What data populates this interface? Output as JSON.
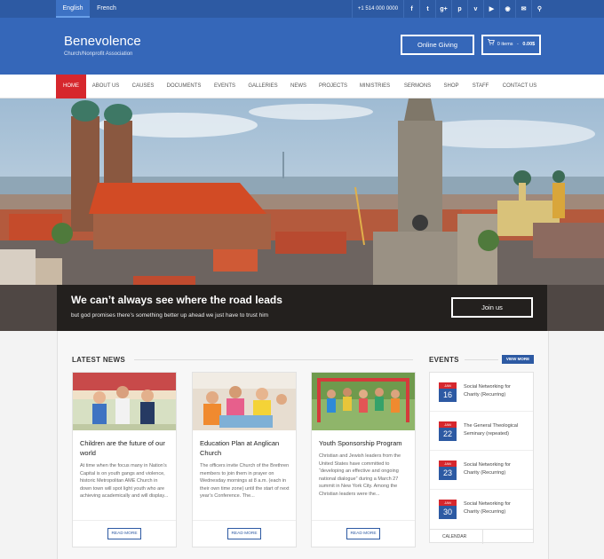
{
  "topbar": {
    "languages": [
      {
        "label": "English",
        "active": true
      },
      {
        "label": "French",
        "active": false
      }
    ],
    "phone": "+1 514 000 0000",
    "social_icons": [
      "facebook-icon",
      "twitter-icon",
      "google-plus-icon",
      "pinterest-icon",
      "vimeo-icon",
      "youtube-icon",
      "rss-icon",
      "email-icon",
      "search-icon"
    ],
    "social_glyphs": [
      "f",
      "t",
      "g+",
      "p",
      "v",
      "▶",
      "◉",
      "✉",
      "⚲"
    ]
  },
  "header": {
    "brand": "Benevolence",
    "tagline": "Church/Nonprofit Association",
    "giving_label": "Online Giving",
    "cart_items": "0 items",
    "cart_sep": " - ",
    "cart_total": "0.00$"
  },
  "nav": {
    "items": [
      "HOME",
      "ABOUT US",
      "CAUSES",
      "DOCUMENTS",
      "EVENTS",
      "GALLERIES",
      "NEWS",
      "PROJECTS",
      "MINISTRIES",
      "SERMONS",
      "SHOP",
      "STAFF",
      "CONTACT US"
    ],
    "active": "HOME"
  },
  "hero": {
    "title": "We can’t always see where the road leads",
    "subtitle": "but god promises there’s something better up ahead we just have to trust him",
    "button": "Join us"
  },
  "news": {
    "title": "LATEST NEWS",
    "read_more": "READ MORE",
    "articles": [
      {
        "title": "Children are the future of our world",
        "excerpt": "At time when the focus many in Nation’s Capital is on youth gangs and violence, historic Metropolitan AME Church in down town will spot light youth who are achieving academically and will display..."
      },
      {
        "title": "Education Plan at Anglican Church",
        "excerpt": "The officers invite Church of the Brethren members to join them in prayer on Wednesday mornings at 8 a.m. (each in their own time zone) until the start of next year’s Conference. The..."
      },
      {
        "title": "Youth Sponsorship Program",
        "excerpt": "Christian and Jewish leaders from the United States have committed to “developing an effective and ongoing national dialogue” during a March 27 summit in New York City. Among the Christian leaders were the..."
      }
    ]
  },
  "events": {
    "title": "EVENTS",
    "view_more": "VIEW MORE",
    "items": [
      {
        "month": "JAN",
        "day": "16",
        "title": "Social Networking for Charity (Recurring)"
      },
      {
        "month": "JAN",
        "day": "22",
        "title": "The General Theological Seminary (repeated)"
      },
      {
        "month": "JAN",
        "day": "23",
        "title": "Social Networking for Charity (Recurring)"
      },
      {
        "month": "JAN",
        "day": "30",
        "title": "Social Networking for Charity (Recurring)"
      }
    ],
    "calendar": "CALENDAR"
  },
  "colors": {
    "primary": "#3567b9",
    "topbar": "#2d5aa3",
    "accent_red": "#d6272d"
  }
}
